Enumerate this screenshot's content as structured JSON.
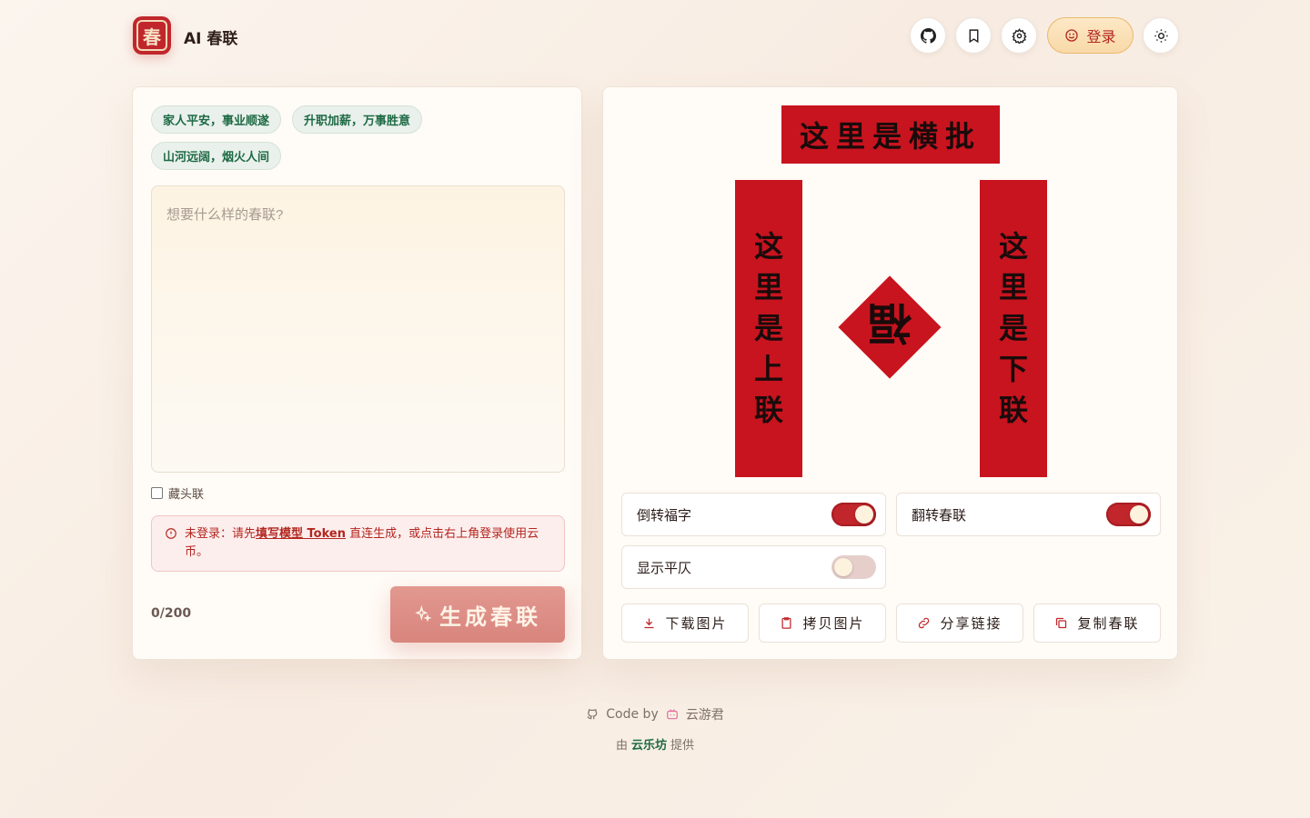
{
  "header": {
    "logo_char": "春",
    "title": "AI 春联",
    "login_label": "登录"
  },
  "chips": [
    "家人平安，事业顺遂",
    "升职加薪，万事胜意",
    "山河远阔，烟火人间"
  ],
  "input": {
    "placeholder": "想要什么样的春联?",
    "value": ""
  },
  "checkbox": {
    "label": "藏头联",
    "checked": false
  },
  "alert": {
    "prefix": "未登录：请先",
    "link": "填写模型 Token",
    "suffix": " 直连生成，或点击右上角登录使用云币。"
  },
  "counter": "0/200",
  "generate_label": "生成春联",
  "couplet": {
    "hengpi": "这里是横批",
    "shanglian": [
      "这",
      "里",
      "是",
      "上",
      "联"
    ],
    "xialian": [
      "这",
      "里",
      "是",
      "下",
      "联"
    ],
    "fu": "福"
  },
  "toggles": [
    {
      "label": "倒转福字",
      "on": true
    },
    {
      "label": "翻转春联",
      "on": true
    },
    {
      "label": "显示平仄",
      "on": false
    }
  ],
  "actions": [
    "下载图片",
    "拷贝图片",
    "分享链接",
    "复制春联"
  ],
  "footer": {
    "code_by": "Code  by",
    "author": "云游君",
    "provided_prefix": "由",
    "provider": "云乐坊",
    "provided_suffix": "提供"
  },
  "colors": {
    "accent_red": "#c8141f",
    "chip_green": "#1e6a45"
  }
}
